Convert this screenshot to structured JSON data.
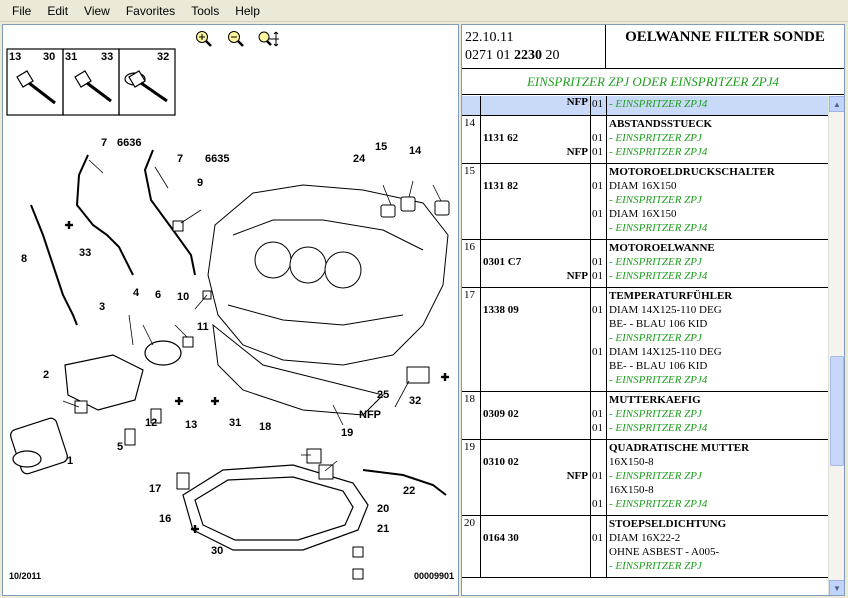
{
  "menu": [
    "File",
    "Edit",
    "View",
    "Favorites",
    "Tools",
    "Help"
  ],
  "diagram": {
    "footer_left": "10/2011",
    "footer_right": "00009901",
    "callouts": [
      "13",
      "30",
      "31",
      "33",
      "32",
      "7",
      "6636",
      "7",
      "6635",
      "24",
      "15",
      "14",
      "9",
      "8",
      "33",
      "4",
      "6",
      "10",
      "3",
      "11",
      "2",
      "1",
      "5",
      "12",
      "13",
      "31",
      "18",
      "19",
      "25",
      "32",
      "NFP",
      "17",
      "16",
      "22",
      "20",
      "21",
      "30"
    ]
  },
  "header": {
    "date": "22.10.11",
    "ref_pre": "0271 01",
    "ref_bold": "2230",
    "ref_post": "20",
    "title": "OELWANNE FILTER SONDE",
    "subtitle": "EINSPRITZER ZPJ ODER EINSPRITZER ZPJ4"
  },
  "rows": [
    {
      "num": "",
      "ref": "",
      "nfp": "NFP",
      "lines": [
        {
          "qty": "01",
          "text": "- EINSPRITZER ZPJ4",
          "style": "green"
        }
      ],
      "selected": true
    },
    {
      "num": "14",
      "ref": "1131 62",
      "nfp": "NFP",
      "lines": [
        {
          "qty": "",
          "text": "ABSTANDSSTUECK",
          "style": "title"
        },
        {
          "qty": "01",
          "text": "- EINSPRITZER ZPJ",
          "style": "green"
        },
        {
          "qty": "01",
          "text": "- EINSPRITZER ZPJ4",
          "style": "green"
        }
      ]
    },
    {
      "num": "15",
      "ref": "1131 82",
      "nfp": "",
      "lines": [
        {
          "qty": "",
          "text": "MOTOROELDRUCKSCHALTER",
          "style": "title"
        },
        {
          "qty": "01",
          "text": "DIAM 16X150",
          "style": "plain"
        },
        {
          "qty": "",
          "text": "- EINSPRITZER ZPJ",
          "style": "green"
        },
        {
          "qty": "01",
          "text": "DIAM 16X150",
          "style": "plain"
        },
        {
          "qty": "",
          "text": "- EINSPRITZER ZPJ4",
          "style": "green"
        }
      ]
    },
    {
      "num": "16",
      "ref": "0301 C7",
      "nfp": "NFP",
      "lines": [
        {
          "qty": "",
          "text": "MOTOROELWANNE",
          "style": "title"
        },
        {
          "qty": "01",
          "text": "- EINSPRITZER ZPJ",
          "style": "green"
        },
        {
          "qty": "01",
          "text": "- EINSPRITZER ZPJ4",
          "style": "green"
        }
      ]
    },
    {
      "num": "17",
      "ref": "1338 09",
      "nfp": "",
      "lines": [
        {
          "qty": "",
          "text": "TEMPERATURFÜHLER",
          "style": "title"
        },
        {
          "qty": "01",
          "text": "DIAM 14X125-110 DEG",
          "style": "plain"
        },
        {
          "qty": "",
          "text": "BE- - BLAU 106 KID",
          "style": "plain"
        },
        {
          "qty": "",
          "text": "- EINSPRITZER ZPJ",
          "style": "green"
        },
        {
          "qty": "01",
          "text": "DIAM 14X125-110 DEG",
          "style": "plain"
        },
        {
          "qty": "",
          "text": "BE- - BLAU 106 KID",
          "style": "plain"
        },
        {
          "qty": "",
          "text": "- EINSPRITZER ZPJ4",
          "style": "green"
        }
      ]
    },
    {
      "num": "18",
      "ref": "0309 02",
      "nfp": "",
      "lines": [
        {
          "qty": "",
          "text": "MUTTERKAEFIG",
          "style": "title"
        },
        {
          "qty": "01",
          "text": "- EINSPRITZER ZPJ",
          "style": "green"
        },
        {
          "qty": "01",
          "text": "- EINSPRITZER ZPJ4",
          "style": "green"
        }
      ]
    },
    {
      "num": "19",
      "ref": "0310 02",
      "nfp": "NFP",
      "lines": [
        {
          "qty": "",
          "text": "QUADRATISCHE MUTTER",
          "style": "title"
        },
        {
          "qty": "",
          "text": "16X150-8",
          "style": "plain"
        },
        {
          "qty": "01",
          "text": "- EINSPRITZER ZPJ",
          "style": "green"
        },
        {
          "qty": "",
          "text": "16X150-8",
          "style": "plain"
        },
        {
          "qty": "01",
          "text": "- EINSPRITZER ZPJ4",
          "style": "green"
        }
      ]
    },
    {
      "num": "20",
      "ref": "0164 30",
      "nfp": "",
      "lines": [
        {
          "qty": "",
          "text": "STOEPSELDICHTUNG",
          "style": "title"
        },
        {
          "qty": "01",
          "text": "DIAM 16X22-2",
          "style": "plain"
        },
        {
          "qty": "",
          "text": "OHNE ASBEST - A005-",
          "style": "plain"
        },
        {
          "qty": "",
          "text": "- EINSPRITZER ZPJ",
          "style": "green"
        }
      ]
    }
  ]
}
